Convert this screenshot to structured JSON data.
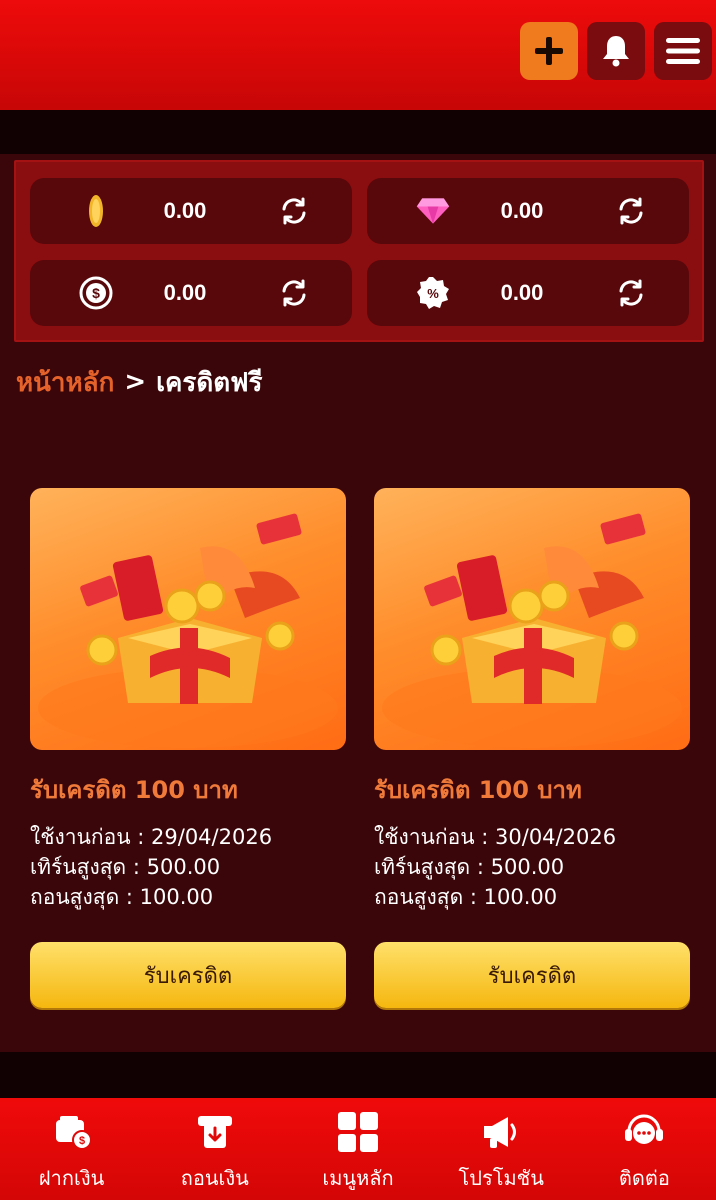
{
  "header": {
    "add_icon": "plus-icon",
    "bell_icon": "bell-icon",
    "menu_icon": "hamburger-menu-icon"
  },
  "balances": [
    {
      "icon": "coin-icon",
      "value": "0.00"
    },
    {
      "icon": "diamond-icon",
      "value": "0.00"
    },
    {
      "icon": "cashback-icon",
      "value": "0.00"
    },
    {
      "icon": "percent-badge-icon",
      "value": "0.00"
    }
  ],
  "breadcrumb": {
    "home": "หน้าหลัก",
    "separator": ">",
    "current": "เครดิตฟรี"
  },
  "cards": [
    {
      "title": "รับเครดิต 100 บาท",
      "use_before": "ใช้งานก่อน : 29/04/2026",
      "max_turnover": "เทิร์นสูงสุด : 500.00",
      "max_withdraw": "ถอนสูงสุด : 100.00",
      "button": "รับเครดิต"
    },
    {
      "title": "รับเครดิต 100 บาท",
      "use_before": "ใช้งานก่อน : 30/04/2026",
      "max_turnover": "เทิร์นสูงสุด : 500.00",
      "max_withdraw": "ถอนสูงสุด : 100.00",
      "button": "รับเครดิต"
    }
  ],
  "bottom_nav": [
    {
      "label": "ฝากเงิน",
      "icon": "deposit-wallet-icon"
    },
    {
      "label": "ถอนเงิน",
      "icon": "withdraw-icon"
    },
    {
      "label": "เมนูหลัก",
      "icon": "grid-menu-icon"
    },
    {
      "label": "โปรโมชัน",
      "icon": "megaphone-icon"
    },
    {
      "label": "ติดต่อ",
      "icon": "chat-support-icon"
    }
  ],
  "colors": {
    "primary_red": "#e00909",
    "accent_orange": "#f07a3a",
    "button_yellow": "#f5b70f",
    "background": "#3b0609"
  }
}
